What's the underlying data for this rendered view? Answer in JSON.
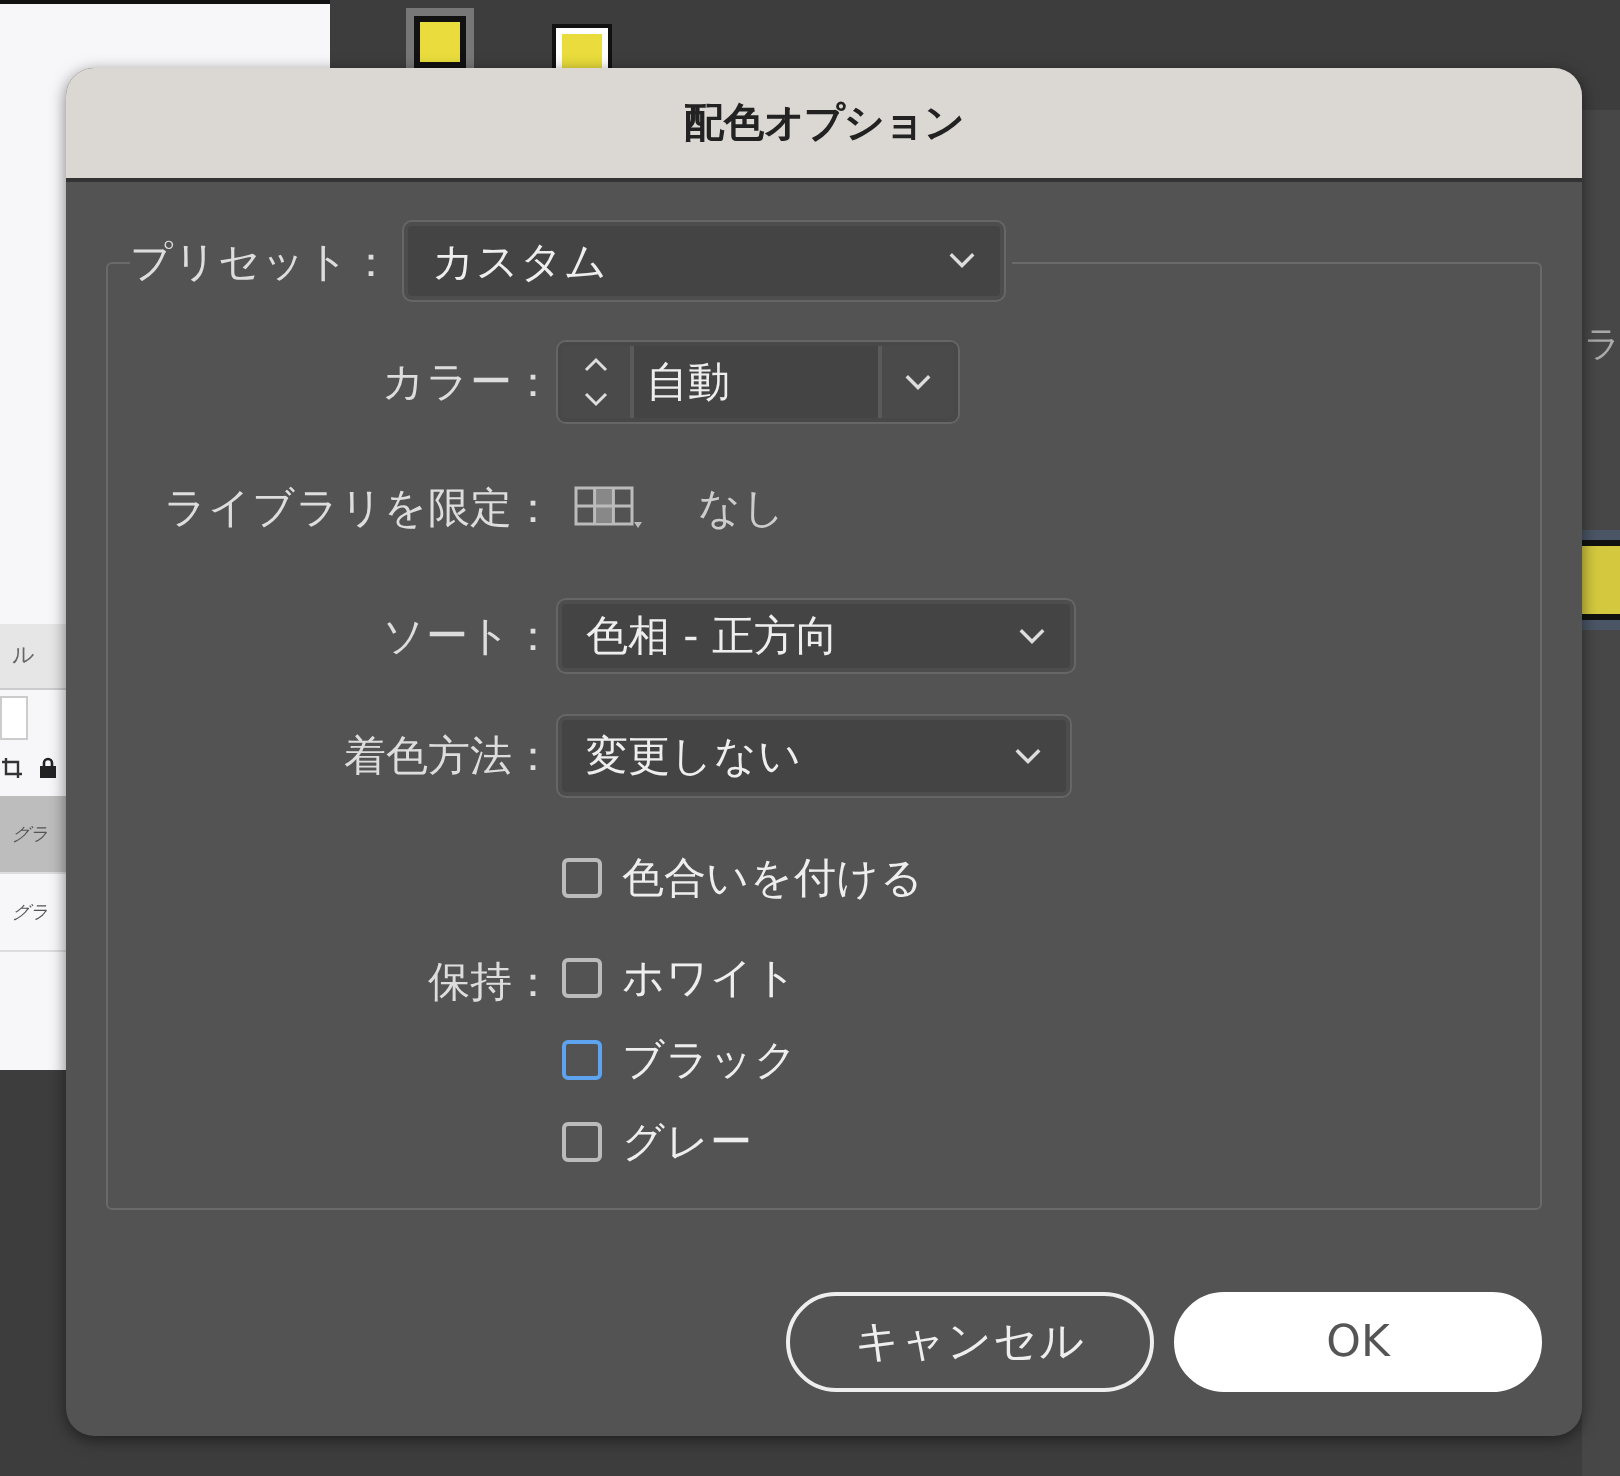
{
  "background": {
    "panel_tab": "ル",
    "layer_rows": [
      "グラ",
      "グラ"
    ],
    "side_label": "ラ"
  },
  "dialog": {
    "title": "配色オプション",
    "preset": {
      "label": "プリセット：",
      "value": "カスタム"
    },
    "colors": {
      "label": "カラー：",
      "value": "自動"
    },
    "library": {
      "label": "ライブラリを限定：",
      "value": "なし"
    },
    "sort": {
      "label": "ソート：",
      "value": "色相 - 正方向"
    },
    "coloring": {
      "label": "着色方法：",
      "value": "変更しない"
    },
    "tint": {
      "label": "色合いを付ける",
      "checked": false,
      "focused": false
    },
    "preserve": {
      "label": "保持：",
      "options": [
        {
          "label": "ホワイト",
          "checked": false,
          "focused": false
        },
        {
          "label": "ブラック",
          "checked": false,
          "focused": true
        },
        {
          "label": "グレー",
          "checked": false,
          "focused": false
        }
      ]
    },
    "buttons": [
      {
        "label": "キャンセル",
        "kind": "secondary"
      },
      {
        "label": "OK",
        "kind": "primary"
      }
    ]
  }
}
